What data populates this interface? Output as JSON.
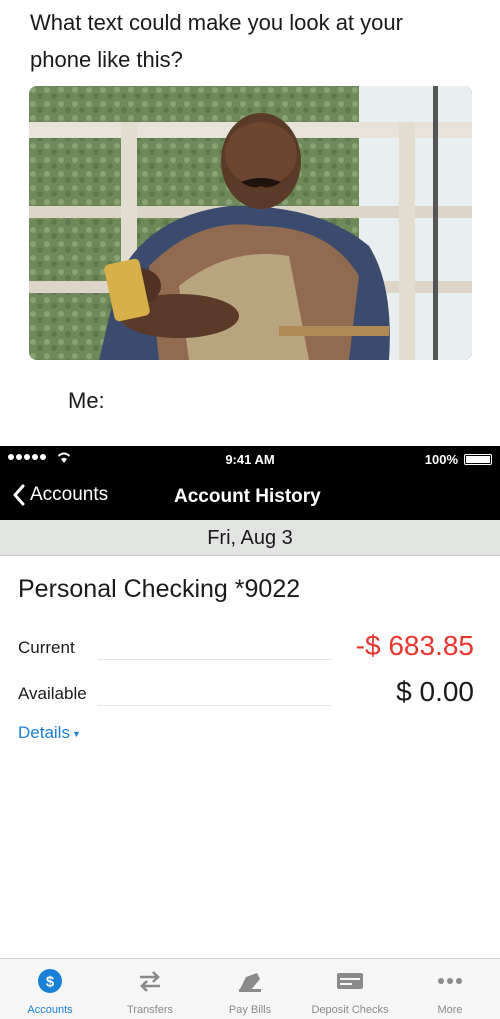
{
  "meme": {
    "caption_line1": "What text could make you look at your",
    "caption_line2": "phone like this?",
    "me_label": "Me:"
  },
  "status_bar": {
    "time": "9:41 AM",
    "battery": "100%"
  },
  "nav": {
    "back_label": "Accounts",
    "title": "Account History"
  },
  "date_header": "Fri, Aug 3",
  "account": {
    "name": "Personal Checking *9022",
    "current_label": "Current",
    "current_value": "-$ 683.85",
    "available_label": "Available",
    "available_value": "$ 0.00",
    "details_label": "Details"
  },
  "tabs": [
    {
      "label": "Accounts",
      "icon": "dollar-icon"
    },
    {
      "label": "Transfers",
      "icon": "transfer-arrows-icon"
    },
    {
      "label": "Pay Bills",
      "icon": "pay-bills-icon"
    },
    {
      "label": "Deposit Checks",
      "icon": "check-icon"
    },
    {
      "label": "More",
      "icon": "more-icon"
    }
  ],
  "colors": {
    "negative": "#e8362f",
    "accent": "#1a7fd6"
  }
}
